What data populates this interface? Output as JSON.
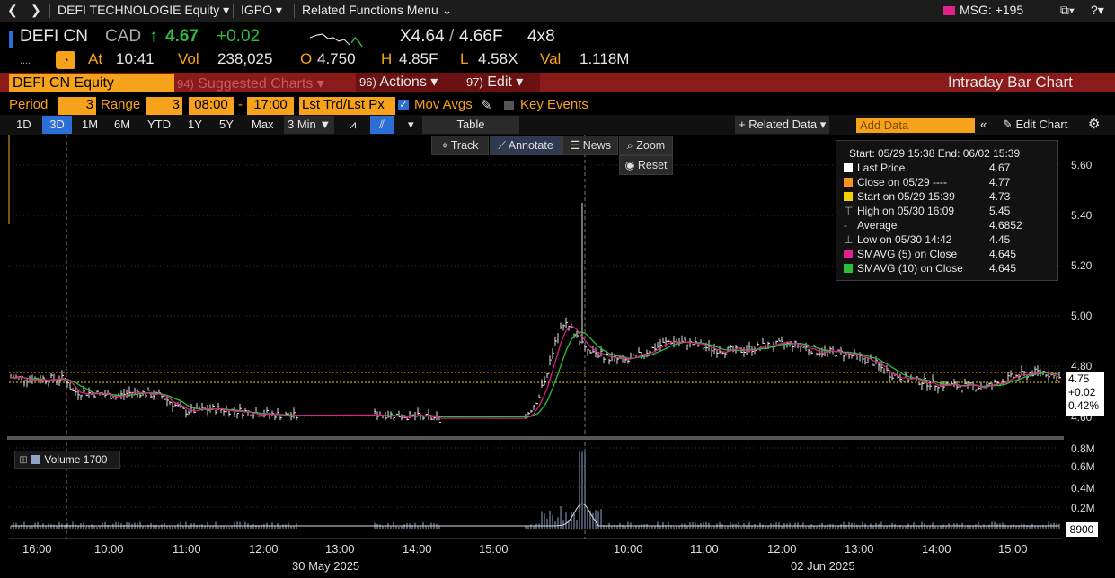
{
  "topbar": {
    "security": "DEFI TECHNOLOGIE Equity",
    "function": "IGPO",
    "related": "Related Functions Menu",
    "msg": "MSG: +195"
  },
  "quote": {
    "ticker": "DEFI CN",
    "currency": "CAD",
    "last": "4.67",
    "change": "+0.02",
    "bid": "X4.64",
    "ask": "4.66F",
    "size": "4x8",
    "at_label": "At",
    "time": "10:41",
    "vol_label": "Vol",
    "vol": "238,025",
    "o_label": "O",
    "open": "4.750",
    "h_label": "H",
    "high": "4.85F",
    "l_label": "L",
    "low": "4.58X",
    "val_label": "Val",
    "val": "1.118M"
  },
  "menubar": {
    "security_field": "DEFI CN Equity",
    "suggested": "Suggested Charts",
    "suggested_num": "94)",
    "actions": "Actions",
    "actions_num": "96)",
    "edit": "Edit",
    "edit_num": "97)",
    "chart_title": "Intraday Bar Chart"
  },
  "options": {
    "period_label": "Period",
    "period_value": "3",
    "range_label": "Range",
    "range_value": "3",
    "start_time": "08:00",
    "end_time": "17:00",
    "price_type": "Lst Trd/Lst Px",
    "mov_avgs": "Mov Avgs",
    "key_events": "Key Events"
  },
  "tabs": [
    "1D",
    "3D",
    "1M",
    "6M",
    "YTD",
    "1Y",
    "5Y",
    "Max"
  ],
  "interval": "3 Min",
  "table_label": "Table",
  "related_data": "Related Data",
  "add_data_placeholder": "Add Data",
  "edit_chart": "Edit Chart",
  "tools": {
    "track": "Track",
    "annotate": "Annotate",
    "news": "News",
    "zoom": "Zoom",
    "reset": "Reset"
  },
  "legend": {
    "header": "Start: 05/29 15:38 End: 06/02 15:39",
    "rows": [
      {
        "label": "Last Price",
        "value": "4.67",
        "color": "#ffffff"
      },
      {
        "label": "Close on 05/29 ----",
        "value": "4.77",
        "color": "#f7931e"
      },
      {
        "label": "Start on 05/29 15:39",
        "value": "4.73",
        "color": "#f5d000"
      },
      {
        "label": "High on 05/30 16:09",
        "value": "5.45",
        "color": "none"
      },
      {
        "label": "Average",
        "value": "4.6852",
        "color": "none"
      },
      {
        "label": "Low on 05/30 14:42",
        "value": "4.45",
        "color": "none"
      },
      {
        "label": "SMAVG (5)  on Close",
        "value": "4.645",
        "color": "#e0218a"
      },
      {
        "label": "SMAVG (10)  on Close",
        "value": "4.645",
        "color": "#2dbd3c"
      }
    ]
  },
  "price_axis": [
    "5.60",
    "5.40",
    "5.20",
    "5.00",
    "4.80",
    "4.60"
  ],
  "last_box": {
    "price": "4.75",
    "change": "+0.02",
    "pct": "0.42%"
  },
  "volume": {
    "label": "Volume 1700",
    "axis": [
      "0.8M",
      "0.6M",
      "0.4M",
      "0.2M"
    ],
    "last": "8900"
  },
  "time_axis": [
    "16:00",
    "10:00",
    "11:00",
    "12:00",
    "13:00",
    "14:00",
    "15:00",
    "10:00",
    "11:00",
    "12:00",
    "13:00",
    "14:00",
    "15:00"
  ],
  "date_labels": [
    "30 May 2025",
    "02 Jun 2025"
  ],
  "colors": {
    "accent": "#f7a21b",
    "menu": "#8b1a1a",
    "up": "#2dbd3c",
    "sma5": "#e0218a",
    "sma10": "#2dbd3c"
  }
}
